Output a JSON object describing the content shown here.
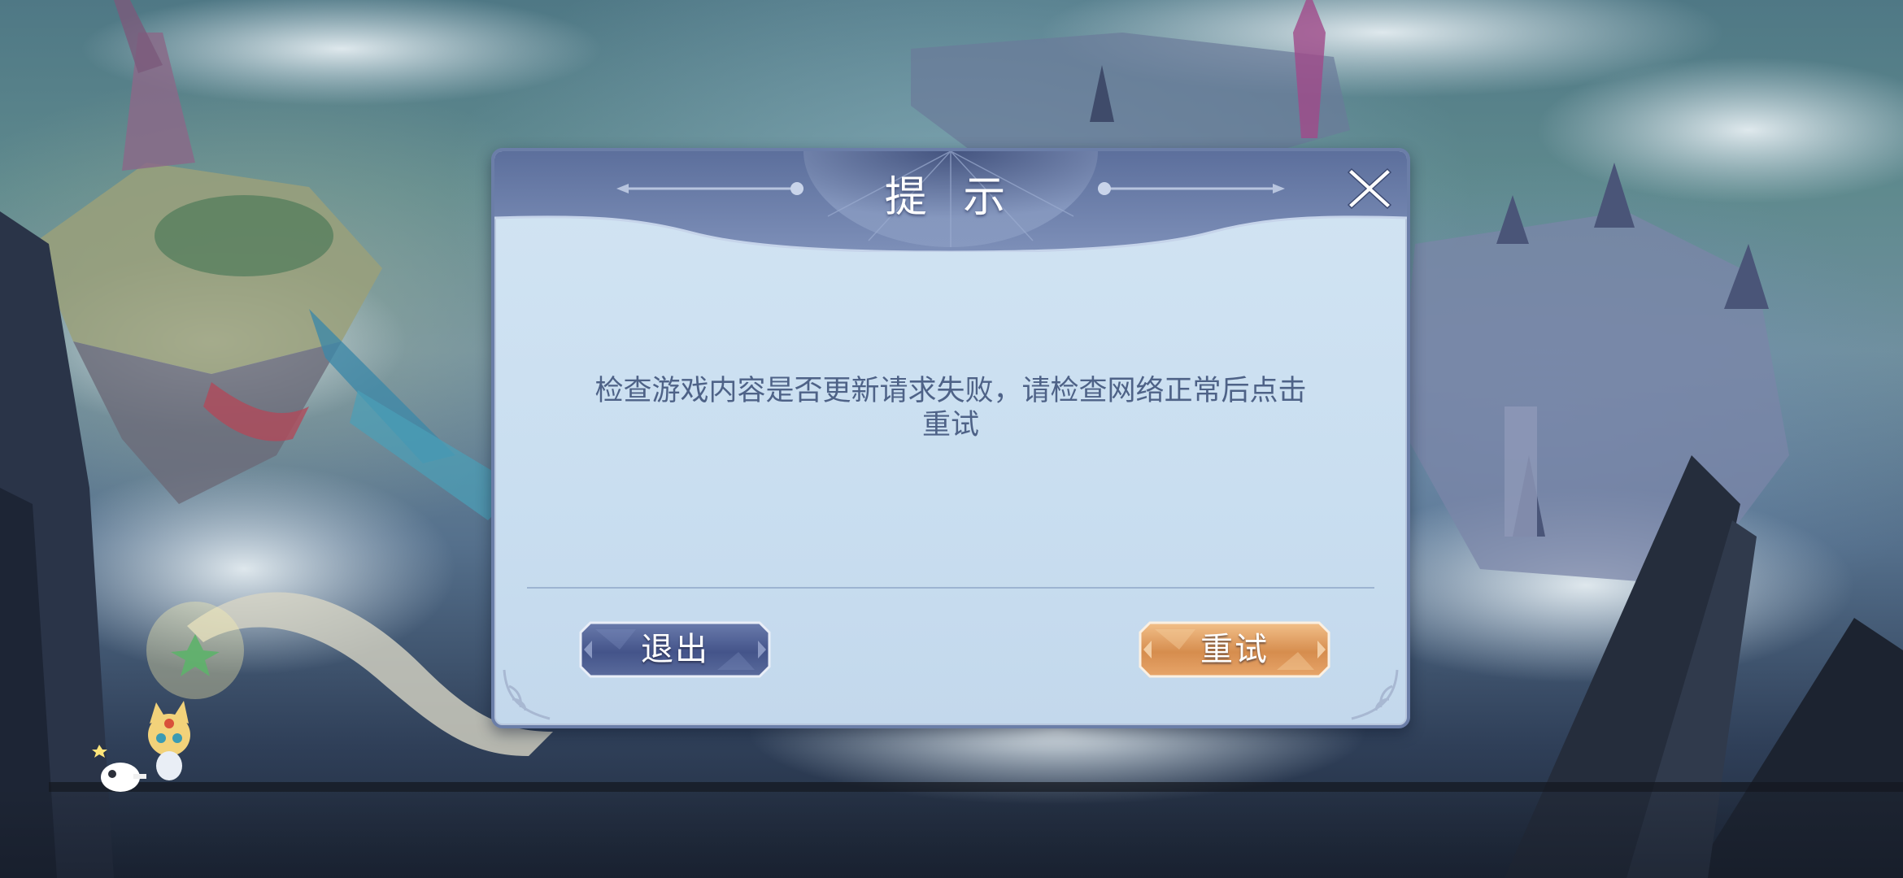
{
  "dialog": {
    "title": "提 示",
    "message_line1": "检查游戏内容是否更新请求失败，请检查网络正常后点击",
    "message_line2": "重试",
    "exit_label": "退出",
    "retry_label": "重试",
    "close_icon": "close-icon"
  },
  "colors": {
    "dialog_bg": "#c9def0",
    "dialog_border": "#6b7ea8",
    "header_bg": "#5a6d98",
    "message_text": "#4e6287",
    "exit_button": "#4a5a8a",
    "retry_button": "#d99a5e"
  },
  "icons": {
    "close": "close-icon",
    "mascot": "mascot-character-icon",
    "corner": "ornament-corner-icon"
  }
}
